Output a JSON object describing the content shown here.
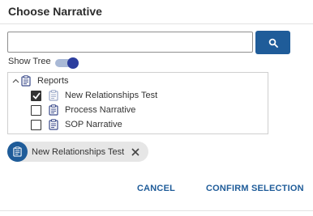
{
  "dialog": {
    "title": "Choose Narrative"
  },
  "search": {
    "value": "",
    "placeholder": "",
    "button_icon": "search-icon"
  },
  "show_tree": {
    "label": "Show Tree",
    "enabled": true
  },
  "tree": {
    "root": {
      "label": "Reports",
      "expanded": true,
      "icon": "document-icon"
    },
    "items": [
      {
        "label": "New Relationships Test",
        "checked": true,
        "icon": "document-icon"
      },
      {
        "label": "Process Narrative",
        "checked": false,
        "icon": "document-icon"
      },
      {
        "label": "SOP Narrative",
        "checked": false,
        "icon": "document-icon"
      }
    ]
  },
  "selected_chips": [
    {
      "label": "New Relationships Test",
      "icon": "document-icon"
    }
  ],
  "actions": {
    "cancel_label": "CANCEL",
    "confirm_label": "CONFIRM SELECTION"
  },
  "colors": {
    "primary": "#1f5c99",
    "toggle_knob": "#2c3e9e",
    "toggle_track": "#a9b9d6",
    "chip_bg": "#e6e6e6"
  }
}
